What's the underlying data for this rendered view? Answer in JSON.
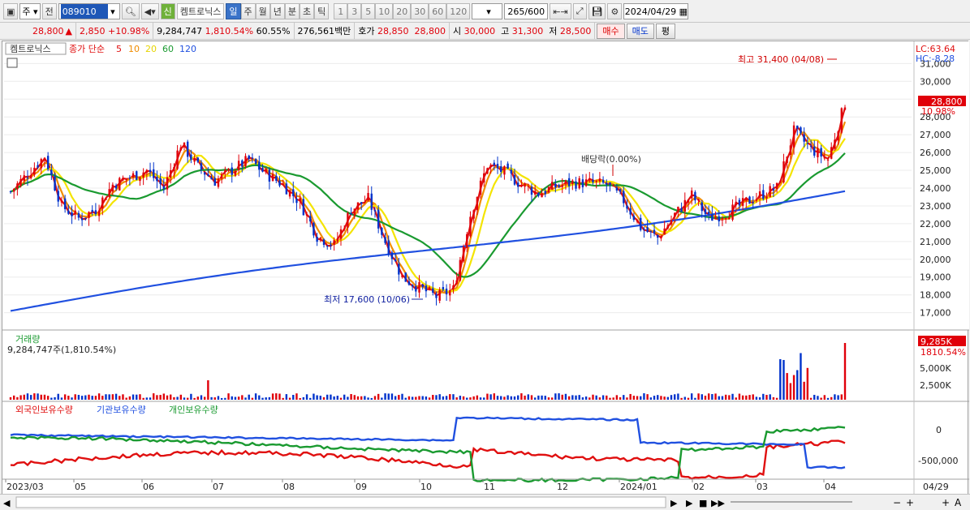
{
  "toolbar": {
    "period_mode": "주",
    "prev_label": "전",
    "stock_code": "089010",
    "stock_badge": "신",
    "stock_name": "켐트로닉스",
    "period_tabs": [
      "일",
      "주",
      "월",
      "년",
      "분",
      "초",
      "틱"
    ],
    "active_period": "일",
    "num_tabs": [
      "1",
      "3",
      "5",
      "10",
      "20",
      "30",
      "60",
      "120"
    ],
    "count_display": "265",
    "count_max": "/600",
    "date": "2024/04/29"
  },
  "quote": {
    "price": "28,800",
    "change_arrow": "▲",
    "change": "2,850",
    "change_pct": "+10.98%",
    "volume": "9,284,747",
    "volume_ratio": "1,810.54%",
    "turnover_pct": "60.55%",
    "amount": "276,561백만",
    "ask_label": "호가",
    "ask": "28,850",
    "bid": "28,800",
    "open_label": "시",
    "open": "30,000",
    "high_label": "고",
    "high": "31,300",
    "low_label": "저",
    "low": "28,500",
    "buy_label": "매수",
    "sell_label": "매도",
    "avg_label": "평"
  },
  "price_panel": {
    "stock_tag": "켐트로닉스",
    "ma_title": "종가 단순",
    "ma_periods": [
      "5",
      "10",
      "20",
      "60",
      "120"
    ],
    "lc_label": "LC:63.64",
    "hc_label": "HC:-8.28",
    "high_annotation": "최고 31,400 (04/08)",
    "low_annotation": "최저 17,600 (10/06)",
    "dividend_annotation": "배당락(0.00%)",
    "current_price_tag": "28,800",
    "current_pct_tag": "10.98%"
  },
  "volume_panel": {
    "title": "거래량",
    "info": "9,284,747주(1,810.54%)",
    "current_tag": "9,285K",
    "current_pct": "1810.54%",
    "ticks": [
      "5,000K",
      "2,500K"
    ]
  },
  "holdings_panel": {
    "series_foreign": "외국인보유수량",
    "series_inst": "기관보유수량",
    "series_indiv": "개인보유수량",
    "ticks": [
      "0",
      "-500,000"
    ]
  },
  "x_axis": {
    "labels": [
      "2023/03",
      "05",
      "06",
      "07",
      "08",
      "09",
      "10",
      "11",
      "12",
      "2024/01",
      "02",
      "03",
      "04"
    ],
    "end_label": "04/29"
  },
  "chart_data": {
    "type": "candlestick",
    "title": "켐트로닉스",
    "price_axis": {
      "ticks": [
        17000,
        18000,
        19000,
        20000,
        21000,
        22000,
        23000,
        24000,
        25000,
        26000,
        27000,
        28000,
        29000,
        30000,
        31000
      ],
      "tick_labels": [
        "17,000",
        "18,000",
        "19,000",
        "20,000",
        "21,000",
        "22,000",
        "23,000",
        "24,000",
        "25,000",
        "26,000",
        "27,000",
        "28,000",
        "29,000",
        "30,000",
        "31,000"
      ],
      "ylim": [
        16300,
        31700
      ]
    },
    "x_months": [
      "2023/03",
      "05",
      "06",
      "07",
      "08",
      "09",
      "10",
      "11",
      "12",
      "2024/01",
      "02",
      "03",
      "04"
    ],
    "weekly_close": [
      23800,
      24800,
      25800,
      23000,
      22300,
      22800,
      24200,
      24600,
      25000,
      24000,
      26500,
      25200,
      24400,
      25000,
      25600,
      24800,
      24200,
      23200,
      21300,
      20800,
      22800,
      23400,
      21000,
      19000,
      18400,
      17900,
      18300,
      22500,
      25300,
      24900,
      24200,
      23700,
      24100,
      24300,
      24300,
      24200,
      23300,
      21800,
      21200,
      22500,
      23600,
      22300,
      22600,
      23100,
      23600,
      24000,
      27200,
      26200,
      25600,
      28800
    ],
    "series": [
      {
        "name": "5",
        "color": "#e01010"
      },
      {
        "name": "10",
        "color": "#f08c00"
      },
      {
        "name": "20",
        "color": "#f4e400"
      },
      {
        "name": "60",
        "color": "#1a9a30"
      },
      {
        "name": "120",
        "color": "#2050e0"
      }
    ],
    "annotations": [
      {
        "label": "최고 31,400 (04/08)",
        "value": 31400
      },
      {
        "label": "최저 17,600 (10/06)",
        "value": 17600
      },
      {
        "label": "배당락(0.00%)"
      }
    ],
    "current": {
      "price": 28800,
      "change_pct": 10.98
    }
  },
  "colors": {
    "up": "#e0000a",
    "down": "#0033cc",
    "ma5": "#e01010",
    "ma10": "#f08c00",
    "ma20": "#f4e400",
    "ma60": "#1a9a30",
    "ma120": "#2050e0",
    "foreign": "#e01010",
    "inst": "#2050e0",
    "indiv": "#1a9a30"
  }
}
